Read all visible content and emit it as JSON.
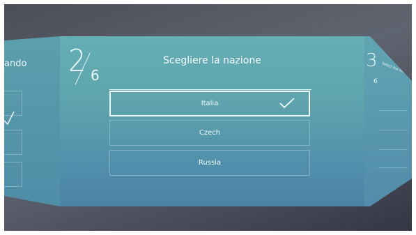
{
  "wizard": {
    "left_panel_title": "ando",
    "current_step": "2",
    "total_steps": "6",
    "title": "Scegliere la nazione",
    "options": [
      {
        "label": "Italia",
        "selected": true
      },
      {
        "label": "Czech",
        "selected": false
      },
      {
        "label": "Russia",
        "selected": false
      }
    ],
    "next_panel": {
      "step": "3",
      "total": "6",
      "title": "Select the time zone"
    }
  },
  "colors": {
    "background": "#4c4e57",
    "panel_top": "#66afb5",
    "panel_bottom": "#4b83a6",
    "text": "#f3fbfc"
  }
}
